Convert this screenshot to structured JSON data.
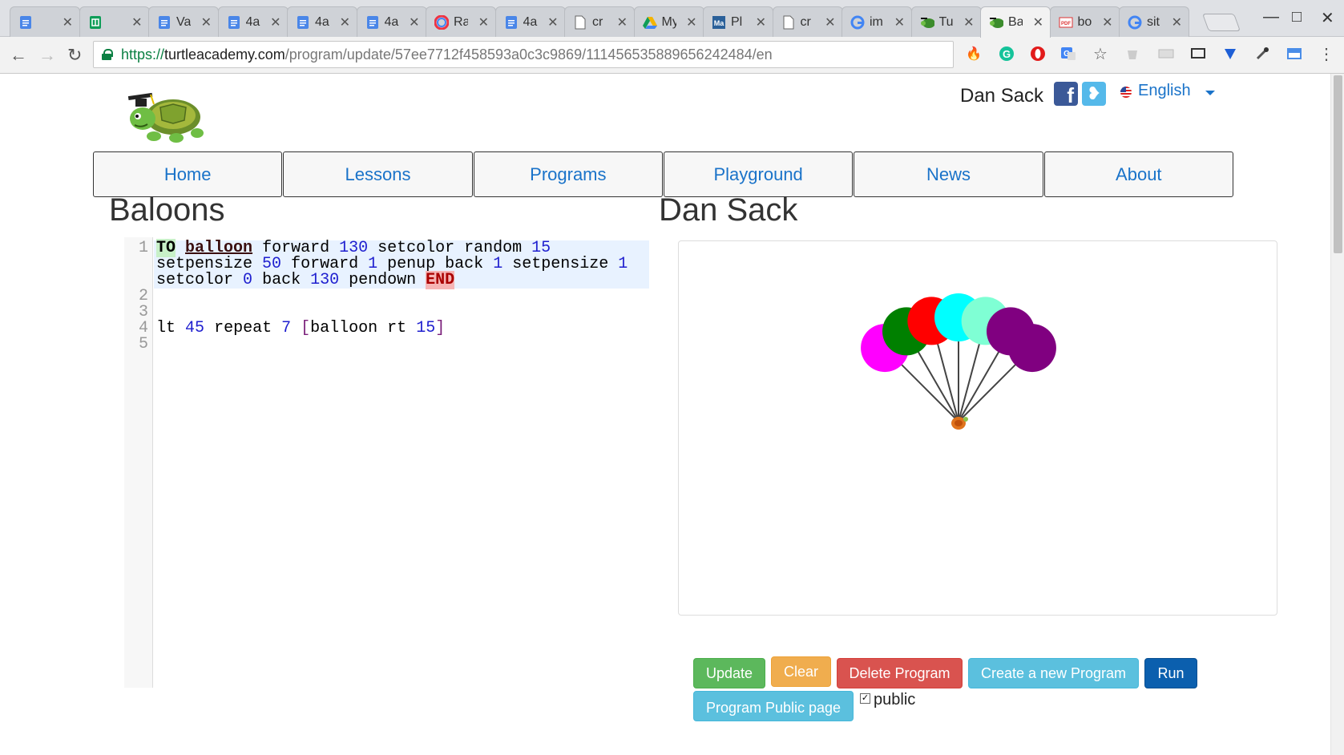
{
  "browser": {
    "tabs": [
      {
        "title": "",
        "icon": "docs-icon",
        "color": "#4a86e8"
      },
      {
        "title": "",
        "icon": "sheets-icon",
        "color": "#0f9d58"
      },
      {
        "title": "Va",
        "icon": "docs-icon",
        "color": "#4a86e8"
      },
      {
        "title": "4a",
        "icon": "docs-icon",
        "color": "#4a86e8"
      },
      {
        "title": "4a",
        "icon": "docs-icon",
        "color": "#4a86e8"
      },
      {
        "title": "4a",
        "icon": "docs-icon",
        "color": "#4a86e8"
      },
      {
        "title": "Ra",
        "icon": "rainbow-icon",
        "color": "#e34"
      },
      {
        "title": "4a",
        "icon": "docs-icon",
        "color": "#4a86e8"
      },
      {
        "title": "cr",
        "icon": "page-icon",
        "color": "#777"
      },
      {
        "title": "My",
        "icon": "drive-icon",
        "color": "#f4b400"
      },
      {
        "title": "Pl",
        "icon": "math-icon",
        "color": "#2a6099"
      },
      {
        "title": "cr",
        "icon": "page-icon",
        "color": "#777"
      },
      {
        "title": "im",
        "icon": "google-icon",
        "color": "#4285f4"
      },
      {
        "title": "Tu",
        "icon": "turtle-icon",
        "color": "#3c8c2c"
      },
      {
        "title": "Ba",
        "icon": "turtle-icon",
        "color": "#3c8c2c",
        "active": true
      },
      {
        "title": "bo",
        "icon": "pdf-icon",
        "color": "#d33"
      },
      {
        "title": "sit",
        "icon": "google-icon",
        "color": "#4285f4"
      }
    ],
    "url": {
      "scheme": "https://",
      "host": "turtleacademy.com",
      "path": "/program/update/57ee7712f458593a0c3c9869/111456535889656242484/en"
    }
  },
  "header": {
    "user_name": "Dan Sack",
    "language": "English"
  },
  "nav": {
    "items": [
      "Home",
      "Lessons",
      "Programs",
      "Playground",
      "News",
      "About"
    ]
  },
  "program": {
    "title": "Baloons",
    "author": "Dan Sack"
  },
  "editor": {
    "line_numbers": [
      "1",
      "2",
      "3",
      "4",
      "5"
    ],
    "line1": {
      "row1": [
        "TO",
        "balloon",
        "forward",
        "130",
        "setcolor random",
        "15"
      ],
      "row2": [
        "setpensize",
        "50",
        "forward",
        "1",
        "penup back",
        "1",
        "setpensize",
        "1"
      ],
      "row3": [
        "setcolor",
        "0",
        "back",
        "130",
        "pendown",
        "END"
      ]
    },
    "line4": [
      "lt",
      "45",
      "repeat",
      "7",
      "[",
      "balloon rt",
      "15",
      "]"
    ]
  },
  "drawing": {
    "balloon_colors": [
      "#ff00ff",
      "#008000",
      "#ff0000",
      "#00ffff",
      "#7fffd4",
      "#800080",
      "#800080"
    ],
    "string_color": "#444444"
  },
  "buttons": {
    "update": "Update",
    "clear": "Clear",
    "delete": "Delete Program",
    "create": "Create a new Program",
    "run": "Run",
    "public_page": "Program Public page",
    "public_label": "public"
  }
}
